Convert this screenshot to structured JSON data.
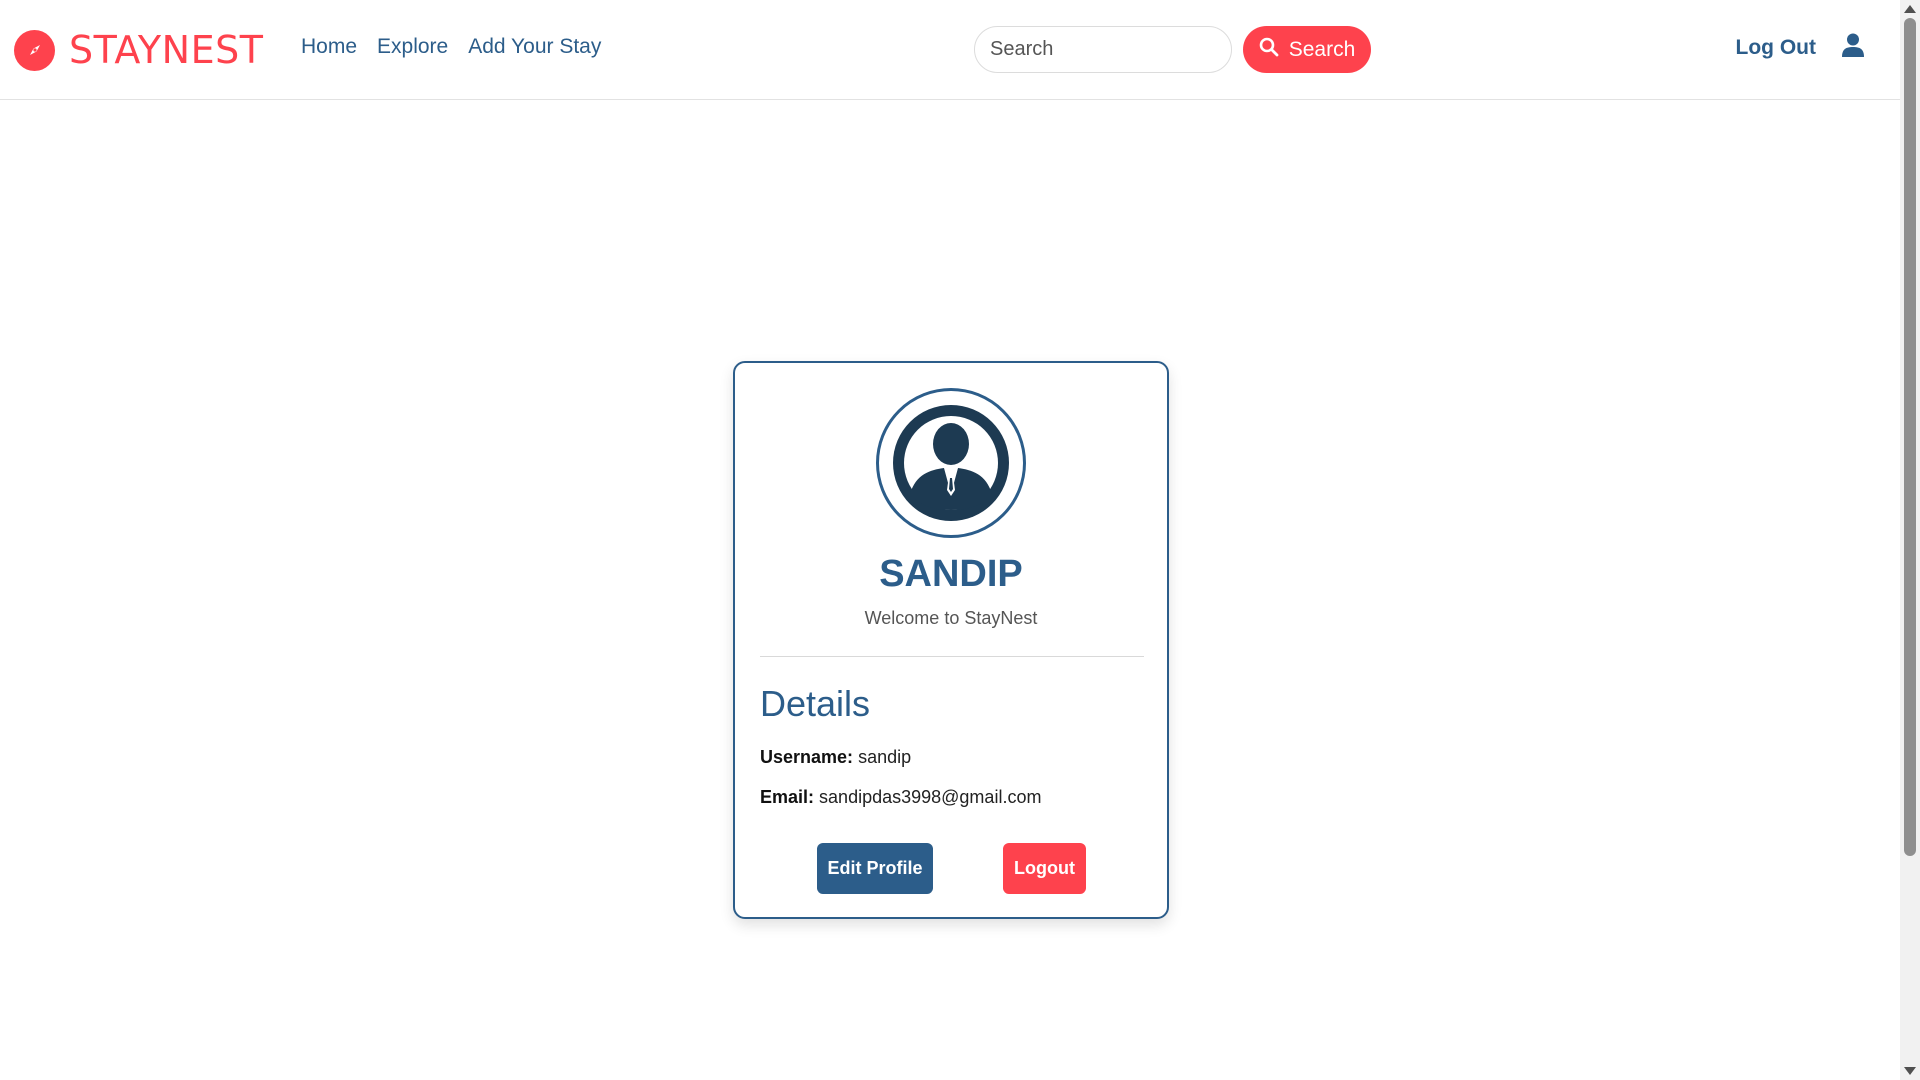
{
  "brand": {
    "name": "STAYNEST",
    "color": "#fe424d"
  },
  "nav": {
    "links": [
      {
        "label": "Home"
      },
      {
        "label": "Explore"
      },
      {
        "label": "Add Your Stay"
      }
    ],
    "search_placeholder": "Search",
    "search_button": "Search",
    "logout_label": "Log Out"
  },
  "profile": {
    "name": "SANDIP",
    "welcome": "Welcome to StayNest",
    "details_title": "Details",
    "username_label": "Username:",
    "username": "sandip",
    "email_label": "Email:",
    "email": "sandipdas3998@gmail.com",
    "edit_button": "Edit Profile",
    "logout_button": "Logout"
  },
  "colors": {
    "primary": "#2c5d8a",
    "accent": "#fe424d"
  }
}
